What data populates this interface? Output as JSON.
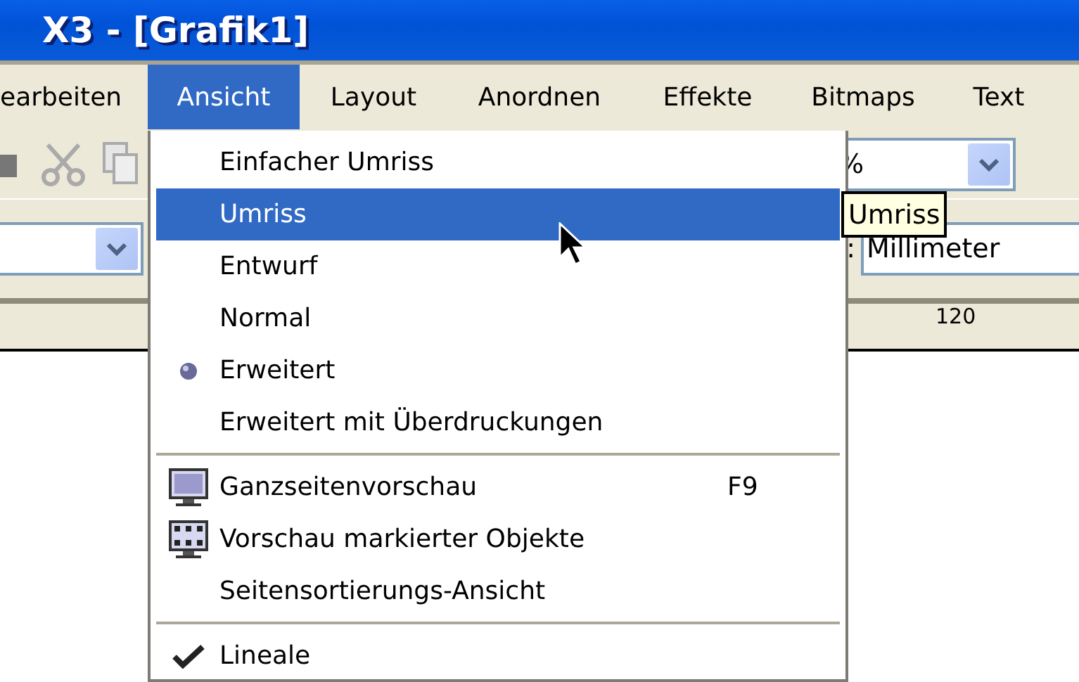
{
  "window": {
    "title": "X3 - [Grafik1]"
  },
  "menu_bar": [
    {
      "label": "earbeiten",
      "selected": false
    },
    {
      "label": "Ansicht",
      "selected": true
    },
    {
      "label": "Layout",
      "selected": false
    },
    {
      "label": "Anordnen",
      "selected": false
    },
    {
      "label": "Effekte",
      "selected": false
    },
    {
      "label": "Bitmaps",
      "selected": false
    },
    {
      "label": "Text",
      "selected": false
    }
  ],
  "toolbar": {
    "zoom_combo": {
      "value": "%"
    },
    "units_label": ":",
    "units_combo": {
      "value": "Millimeter"
    }
  },
  "ruler": {
    "label": "120"
  },
  "dropdown": [
    {
      "kind": "radio",
      "label": "Einfacher Umriss",
      "checked": false,
      "selected": false
    },
    {
      "kind": "radio",
      "label": "Umriss",
      "checked": false,
      "selected": true
    },
    {
      "kind": "radio",
      "label": "Entwurf",
      "checked": false,
      "selected": false
    },
    {
      "kind": "radio",
      "label": "Normal",
      "checked": false,
      "selected": false
    },
    {
      "kind": "radio",
      "label": "Erweitert",
      "checked": true,
      "selected": false
    },
    {
      "kind": "radio",
      "label": "Erweitert mit Überdruckungen",
      "checked": false,
      "selected": false
    },
    {
      "kind": "separator"
    },
    {
      "kind": "pagepreview",
      "label": "Ganzseitenvorschau",
      "shortcut": "F9",
      "selected": false
    },
    {
      "kind": "selectionpreview",
      "label": "Vorschau markierter Objekte",
      "selected": false
    },
    {
      "kind": "command",
      "label": "Seitensortierungs-Ansicht",
      "selected": false
    },
    {
      "kind": "separator"
    },
    {
      "kind": "check",
      "label": "Lineale",
      "checked": true,
      "selected": false
    }
  ],
  "tooltip": {
    "text": "Umriss"
  }
}
